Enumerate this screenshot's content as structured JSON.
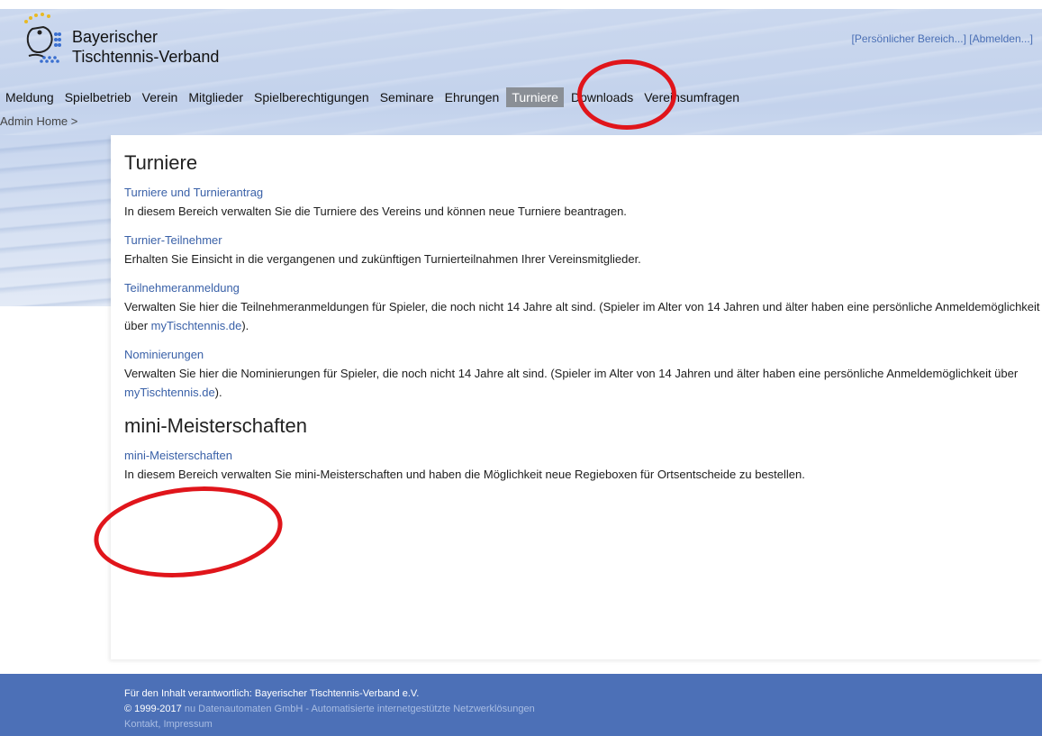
{
  "header": {
    "brand_line1": "Bayerischer",
    "brand_line2": "Tischtennis-Verband",
    "personal_link": "[Persönlicher Bereich...]",
    "logout_link": "[Abmelden...]"
  },
  "nav": {
    "items": [
      {
        "label": "Meldung"
      },
      {
        "label": "Spielbetrieb"
      },
      {
        "label": "Verein"
      },
      {
        "label": "Mitglieder"
      },
      {
        "label": "Spielberechtigungen"
      },
      {
        "label": "Seminare"
      },
      {
        "label": "Ehrungen"
      },
      {
        "label": "Turniere"
      },
      {
        "label": "Downloads"
      },
      {
        "label": "Vereinsumfragen"
      }
    ],
    "active": "Turniere"
  },
  "breadcrumb": "Admin Home >",
  "main": {
    "section1_title": "Turniere",
    "items": [
      {
        "link": "Turniere und Turnierantrag",
        "text": "In diesem Bereich verwalten Sie die Turniere des Vereins und können neue Turniere beantragen."
      },
      {
        "link": "Turnier-Teilnehmer",
        "text": "Erhalten Sie Einsicht in die vergangenen und zukünftigen Turnierteilnahmen Ihrer Vereinsmitglieder."
      },
      {
        "link": "Teilnehmeranmeldung",
        "text": "Verwalten Sie hier die Teilnehmeranmeldungen für Spieler, die noch nicht 14 Jahre alt sind. (Spieler im Alter von 14 Jahren und älter haben eine persönliche Anmeldemöglichkeit über",
        "inline_link": "myTischtennis.de",
        "tail": ")."
      },
      {
        "link": "Nominierungen",
        "text": "Verwalten Sie hier die Nominierungen für Spieler, die noch nicht 14 Jahre alt sind. (Spieler im Alter von 14 Jahren und älter haben eine persönliche Anmeldemöglichkeit über",
        "inline_link": "myTischtennis.de",
        "tail": ")."
      }
    ],
    "section2_title": "mini-Meisterschaften",
    "section2_items": [
      {
        "link": "mini-Meisterschaften",
        "text": "In diesem Bereich verwalten Sie mini-Meisterschaften und haben die Möglichkeit neue Regieboxen für Ortsentscheide zu bestellen."
      }
    ]
  },
  "footer": {
    "responsible": "Für den Inhalt verantwortlich: Bayerischer Tischtennis-Verband e.V.",
    "copyright": "© 1999-2017",
    "company": "nu Datenautomaten GmbH - Automatisierte internetgestützte Netzwerklösungen",
    "contact": "Kontakt",
    "separator": ", ",
    "imprint": "Impressum"
  },
  "colors": {
    "link": "#3a61a8",
    "footer_bg": "#4c70b7",
    "nav_active_bg": "#8a8f96",
    "annotation_red": "#e0151b"
  }
}
